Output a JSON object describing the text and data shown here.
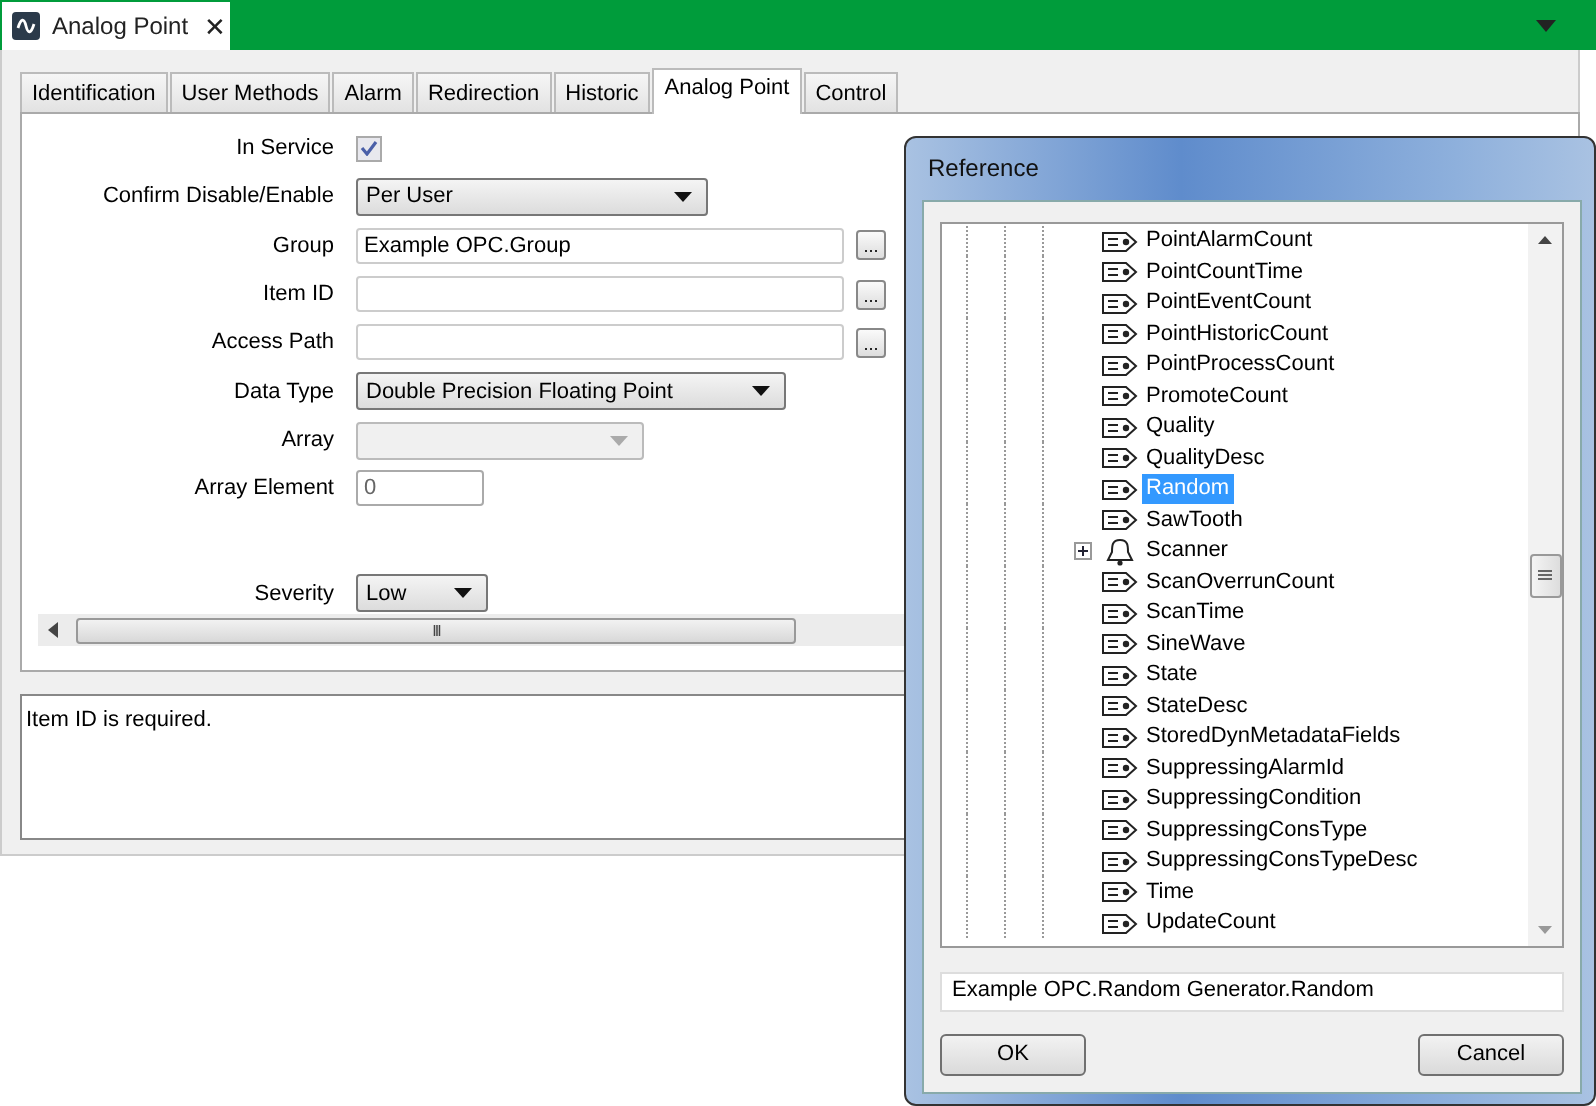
{
  "document_tab": {
    "title": "Analog Point",
    "close": "✕"
  },
  "tabs": [
    {
      "label": "Identification",
      "selected": false
    },
    {
      "label": "User Methods",
      "selected": false
    },
    {
      "label": "Alarm",
      "selected": false
    },
    {
      "label": "Redirection",
      "selected": false
    },
    {
      "label": "Historic",
      "selected": false
    },
    {
      "label": "Analog Point",
      "selected": true
    },
    {
      "label": "Control",
      "selected": false
    }
  ],
  "form": [
    {
      "kind": "checkbox",
      "label": "In Service",
      "checked": true
    },
    {
      "kind": "select",
      "label": "Confirm Disable/Enable",
      "value": "Per User",
      "disabled": false
    },
    {
      "kind": "browse",
      "label": "Group",
      "value": "Example OPC.Group",
      "button": "..."
    },
    {
      "kind": "browse",
      "label": "Item ID",
      "button": "..."
    },
    {
      "kind": "browse",
      "label": "Access Path",
      "button": "..."
    },
    {
      "kind": "select",
      "label": "Data Type",
      "value": "Double Precision Floating Point",
      "disabled": false
    },
    {
      "kind": "select",
      "label": "Array",
      "disabled": true
    },
    {
      "kind": "number",
      "label": "Array Element",
      "value": "0"
    },
    {
      "kind": "gap"
    },
    {
      "kind": "small_select",
      "label": "Severity",
      "value": "Low",
      "disabled": false
    }
  ],
  "scrollbar_grip": "III",
  "message": "Item ID is required.",
  "dialog": {
    "title": "Reference",
    "tree": [
      {
        "kind": "tag",
        "label": "PointAlarmCount",
        "selected": false
      },
      {
        "kind": "tag",
        "label": "PointCountTime",
        "selected": false
      },
      {
        "kind": "tag",
        "label": "PointEventCount",
        "selected": false
      },
      {
        "kind": "tag",
        "label": "PointHistoricCount",
        "selected": false
      },
      {
        "kind": "tag",
        "label": "PointProcessCount",
        "selected": false
      },
      {
        "kind": "tag",
        "label": "PromoteCount",
        "selected": false
      },
      {
        "kind": "tag",
        "label": "Quality",
        "selected": false
      },
      {
        "kind": "tag",
        "label": "QualityDesc",
        "selected": false
      },
      {
        "kind": "tag",
        "label": "Random",
        "selected": true
      },
      {
        "kind": "tag",
        "label": "SawTooth",
        "selected": false
      },
      {
        "kind": "alarm",
        "label": "Scanner",
        "selected": false,
        "expanded": false
      },
      {
        "kind": "tag",
        "label": "ScanOverrunCount",
        "selected": false
      },
      {
        "kind": "tag",
        "label": "ScanTime",
        "selected": false
      },
      {
        "kind": "tag",
        "label": "SineWave",
        "selected": false
      },
      {
        "kind": "tag",
        "label": "State",
        "selected": false
      },
      {
        "kind": "tag",
        "label": "StateDesc",
        "selected": false
      },
      {
        "kind": "tag",
        "label": "StoredDynMetadataFields",
        "selected": false
      },
      {
        "kind": "tag",
        "label": "SuppressingAlarmId",
        "selected": false
      },
      {
        "kind": "tag",
        "label": "SuppressingCondition",
        "selected": false
      },
      {
        "kind": "tag",
        "label": "SuppressingConsType",
        "selected": false
      },
      {
        "kind": "tag",
        "label": "SuppressingConsTypeDesc",
        "selected": false
      },
      {
        "kind": "tag",
        "label": "Time",
        "selected": false
      },
      {
        "kind": "tag",
        "label": "UpdateCount",
        "selected": false
      }
    ],
    "path": "Example OPC.Random Generator.Random",
    "buttons": [
      "OK",
      "Cancel"
    ]
  }
}
